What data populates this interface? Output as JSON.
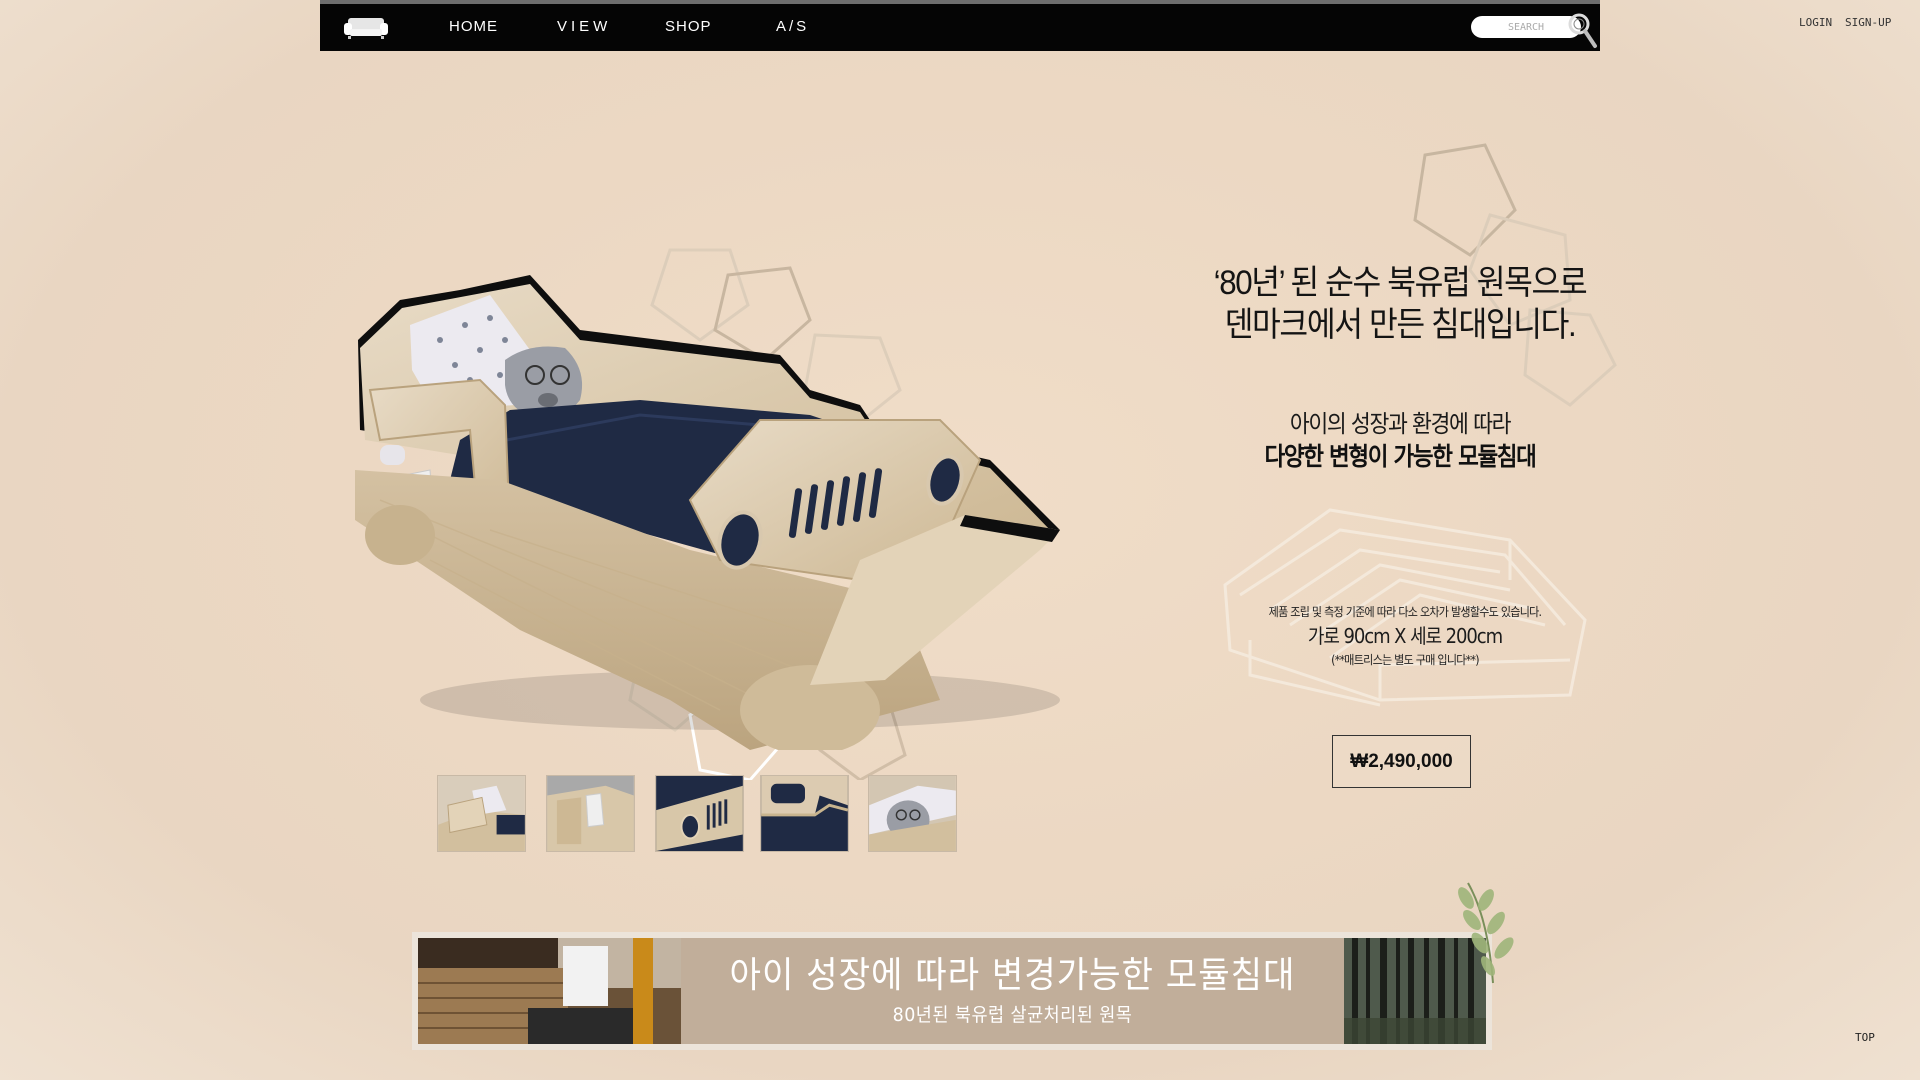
{
  "nav": {
    "links": [
      "HOME",
      "VIEW",
      "SHOP",
      "A/S"
    ],
    "search_placeholder": "SEARCH"
  },
  "auth": {
    "login": "LOGIN",
    "signup": "SIGN-UP"
  },
  "product": {
    "headline_line1": "‘80년’ 된 순수 북유럽 원목으로",
    "headline_line2": "덴마크에서 만든 침대입니다.",
    "sub_line1": "아이의 성장과 환경에 따라",
    "sub_line2": "다양한 변형이 가능한 모듈침대",
    "note": "제품 조립 및 측정 기준에 따라 다소 오차가 발생할수도 있습니다.",
    "dimensions": "가로 90cm X 세로 200cm",
    "mattress_note": "(**매트리스는 별도 구매 입니다**)",
    "price": "₩2,490,000"
  },
  "banner": {
    "title": "아이 성장에 따라 변경가능한 모듈침대",
    "subtitle": "80년된 북유럽 살균처리된 원목"
  },
  "footer": {
    "top": "TOP"
  },
  "colors": {
    "background": "#ecd8c3",
    "navbar": "#050505",
    "banner": "#c1ae9a",
    "wood": "#dccbb1",
    "bedding": "#1f2a44"
  }
}
